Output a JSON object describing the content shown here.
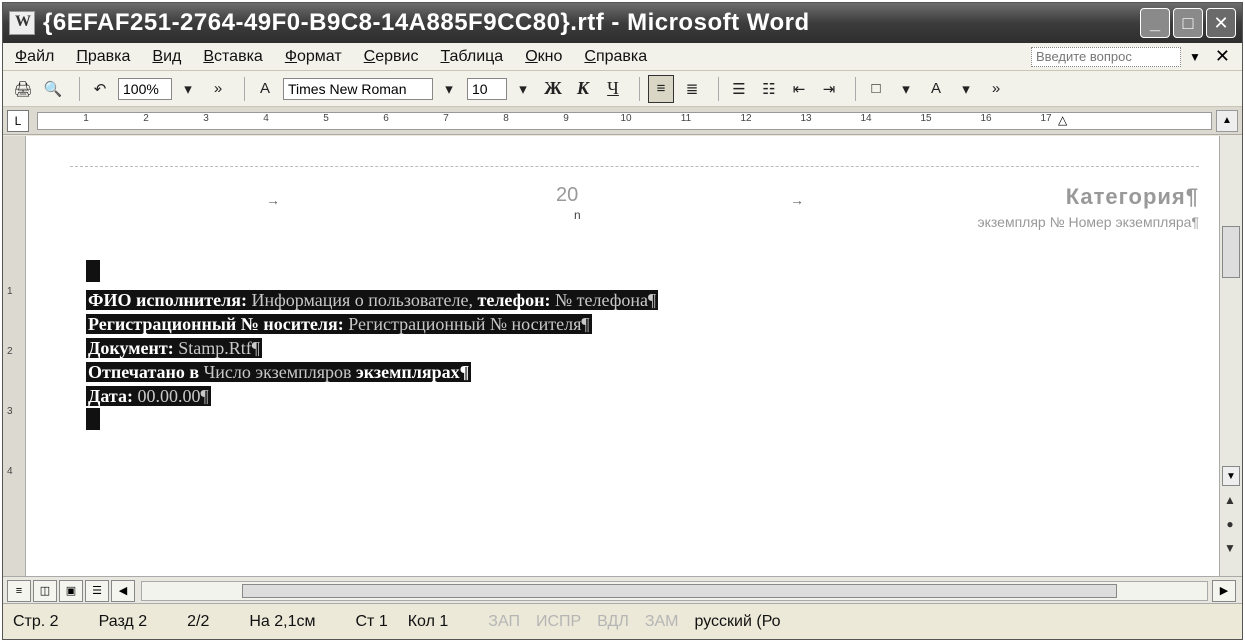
{
  "window": {
    "title": "{6EFAF251-2764-49F0-B9C8-14A885F9CC80}.rtf - Microsoft Word",
    "buttons": {
      "minimize": "_",
      "maximize": "□",
      "close": "✕"
    }
  },
  "menu": {
    "items": [
      "Файл",
      "Правка",
      "Вид",
      "Вставка",
      "Формат",
      "Сервис",
      "Таблица",
      "Окно",
      "Справка"
    ],
    "ask_placeholder": "Введите вопрос",
    "close": "✕"
  },
  "toolbar": {
    "zoom": "100%",
    "font_name": "Times New Roman",
    "font_size": "10",
    "bold": "Ж",
    "italic": "К",
    "underline": "Ч"
  },
  "ruler": {
    "numbers": [
      "1",
      "2",
      "3",
      "4",
      "5",
      "6",
      "7",
      "8",
      "9",
      "10",
      "11",
      "12",
      "13",
      "14",
      "15",
      "16",
      "17"
    ]
  },
  "document": {
    "header": {
      "center_field": "20",
      "center_small": "n",
      "category": "Категория¶",
      "copy": "экземпляр № Номер экземпляра¶"
    },
    "lines": [
      {
        "label": "ФИО исполнителя:",
        "value": " Информация о пользователе, ",
        "label2": "телефон:",
        "value2": " № телефона¶"
      },
      {
        "label": "Регистрационный № носителя:",
        "value": " Регистрационный № носителя¶",
        "label2": "",
        "value2": ""
      },
      {
        "label": "Документ:",
        "value": " Stamp.Rtf¶",
        "label2": "",
        "value2": ""
      },
      {
        "label": "Отпечатано в ",
        "value": "Число экземпляров",
        "label2": " экземплярах¶",
        "value2": ""
      },
      {
        "label": "Дата:",
        "value": " 00.00.00¶",
        "label2": "",
        "value2": ""
      }
    ]
  },
  "status": {
    "page": "Стр. 2",
    "section": "Разд 2",
    "pages": "2/2",
    "at": "На 2,1см",
    "line": "Ст 1",
    "col": "Кол 1",
    "rec": "ЗАП",
    "trk": "ИСПР",
    "ext": "ВДЛ",
    "ovr": "ЗАМ",
    "language": "русский (Ро"
  }
}
